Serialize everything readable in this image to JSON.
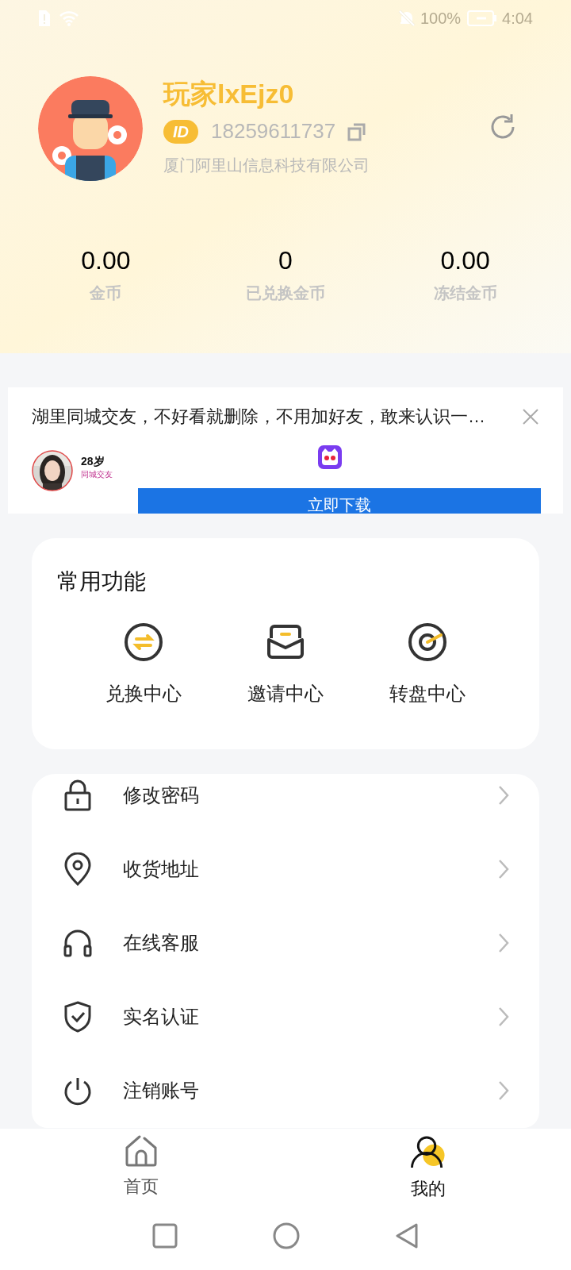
{
  "status_bar": {
    "battery": "100%",
    "time": "4:04"
  },
  "profile": {
    "name": "玩家lxEjz0",
    "id_badge": "ID",
    "phone": "18259611737",
    "company": "厦门阿里山信息科技有限公司"
  },
  "stats": [
    {
      "value": "0.00",
      "label": "金币"
    },
    {
      "value": "0",
      "label": "已兑换金币"
    },
    {
      "value": "0.00",
      "label": "冻结金币"
    }
  ],
  "ad": {
    "title": "湖里同城交友，不好看就删除，不用加好友，敢来认识一…",
    "age": "28岁",
    "tag": "同城交友",
    "button": "立即下载"
  },
  "common_functions": {
    "title": "常用功能",
    "items": [
      {
        "kind": "exchange",
        "label": "兑换中心"
      },
      {
        "kind": "invite",
        "label": "邀请中心"
      },
      {
        "kind": "wheel",
        "label": "转盘中心"
      }
    ]
  },
  "menu": [
    {
      "kind": "lock",
      "label": "修改密码"
    },
    {
      "kind": "location",
      "label": "收货地址"
    },
    {
      "kind": "headset",
      "label": "在线客服"
    },
    {
      "kind": "shield",
      "label": "实名认证"
    },
    {
      "kind": "power",
      "label": "注销账号"
    }
  ],
  "tab_bar": [
    {
      "kind": "home",
      "label": "首页",
      "selected": false
    },
    {
      "kind": "me",
      "label": "我的",
      "selected": true
    }
  ]
}
